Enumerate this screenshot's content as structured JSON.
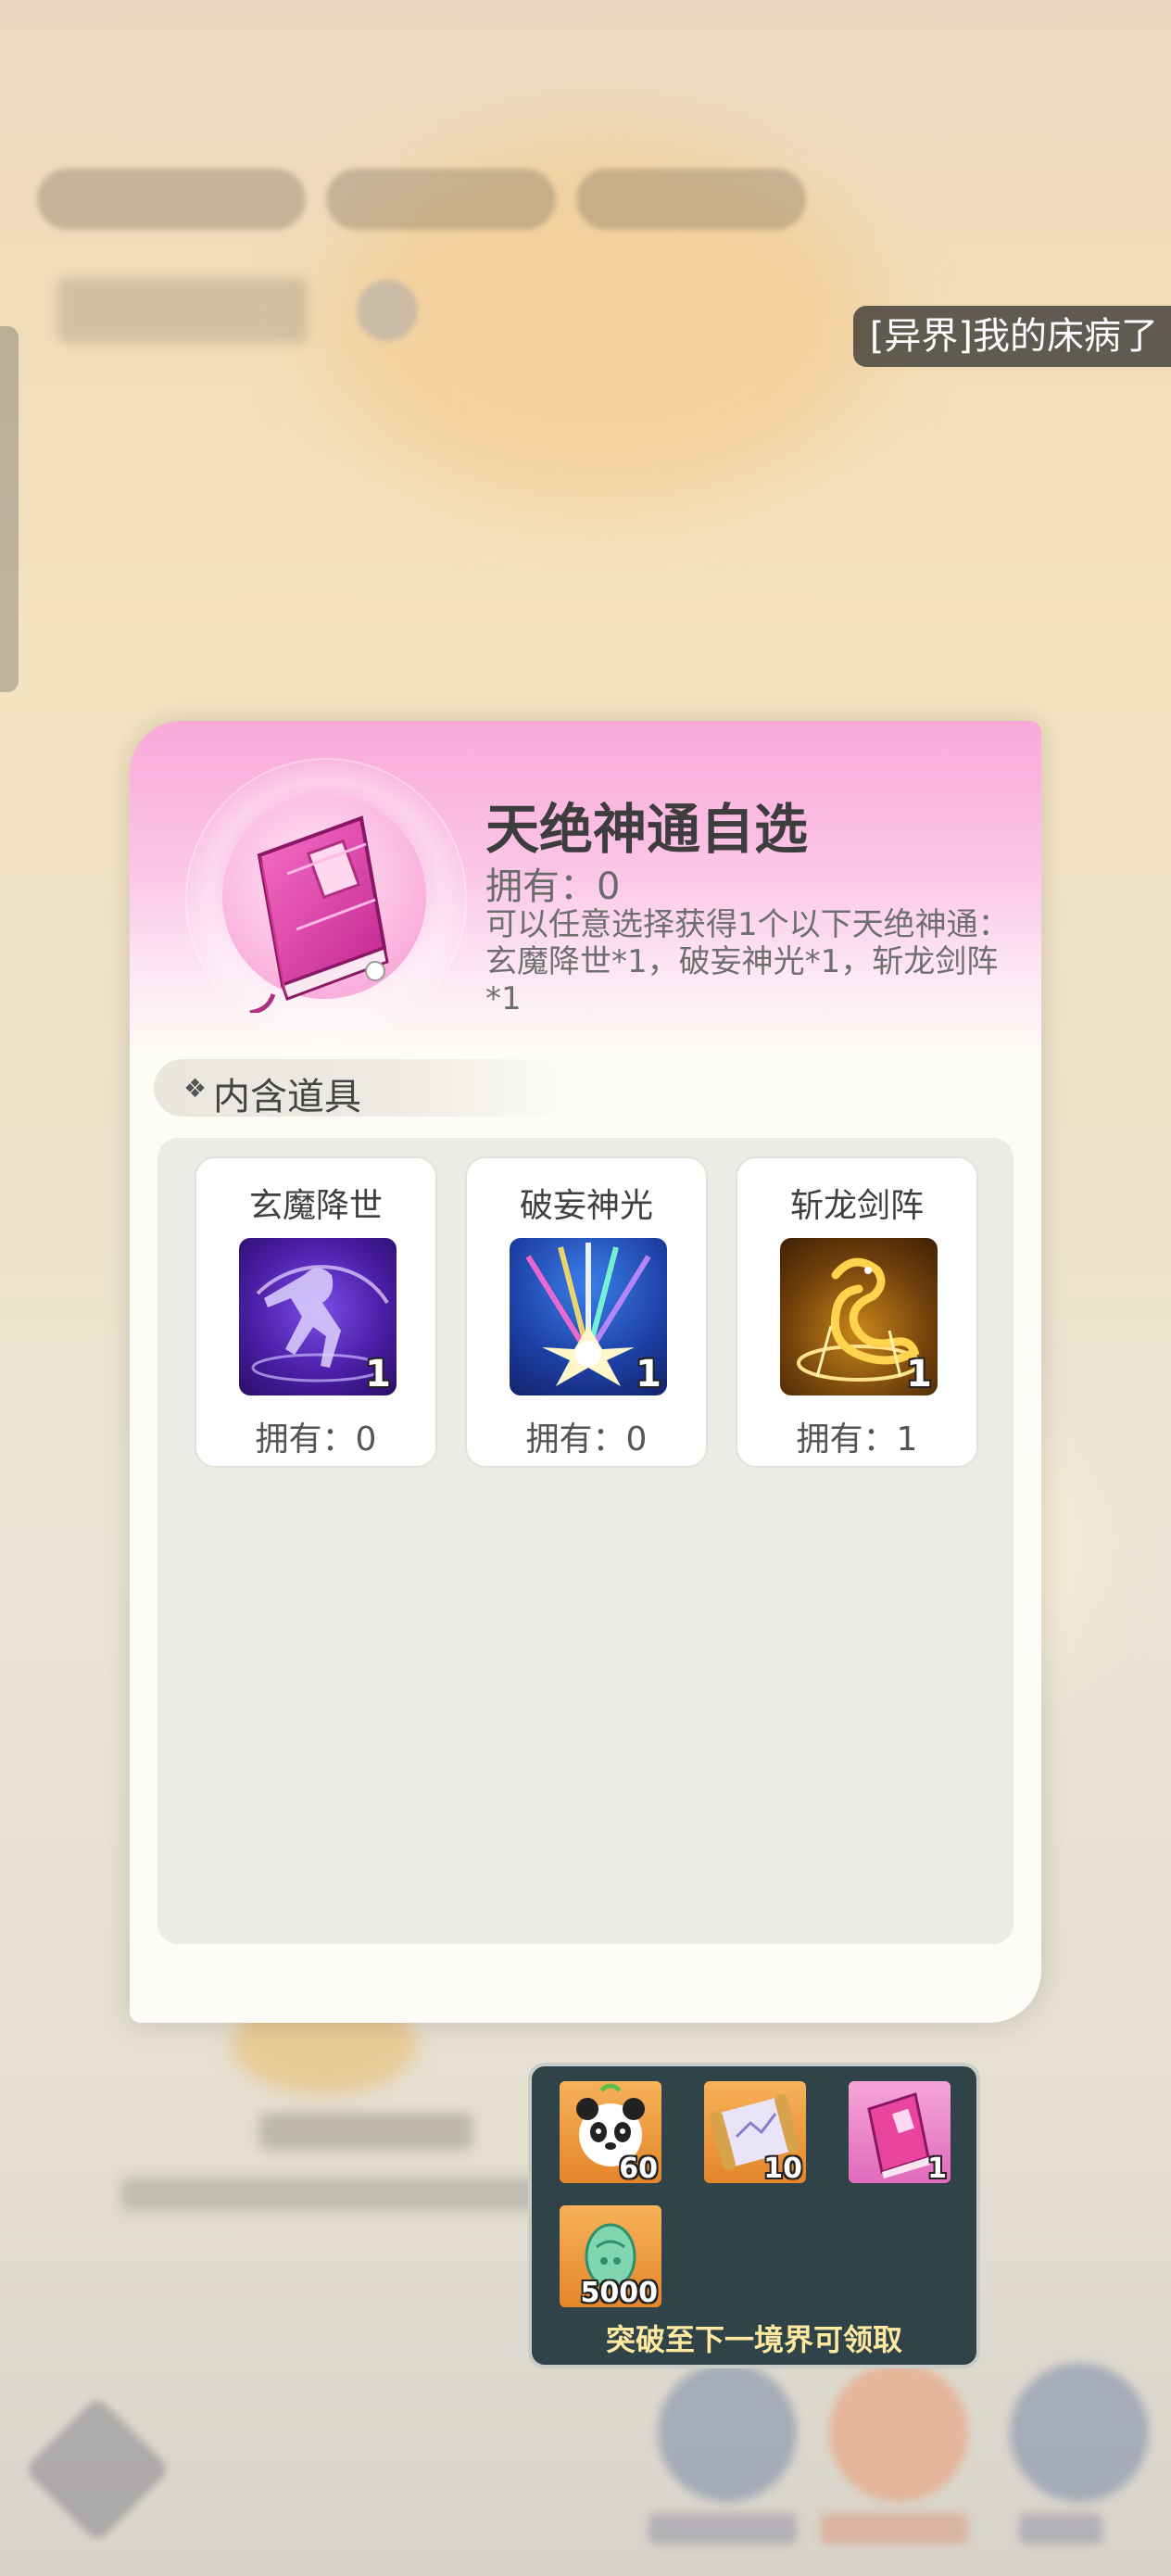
{
  "notice": {
    "text": "[异界]我的床病了"
  },
  "dialog": {
    "title": "天绝神通自选",
    "owned": "拥有：0",
    "description": "可以任意选择获得1个以下天绝神通：玄魔降世*1，破妄神光*1，斩龙剑阵*1",
    "section_label": "内含道具",
    "items": [
      {
        "name": "玄魔降世",
        "qty": "1",
        "owned": "拥有：0",
        "icon": "shadow-demon-icon"
      },
      {
        "name": "破妄神光",
        "qty": "1",
        "owned": "拥有：0",
        "icon": "divine-light-burst-icon"
      },
      {
        "name": "斩龙剑阵",
        "qty": "1",
        "owned": "拥有：1",
        "icon": "golden-dragon-icon"
      }
    ]
  },
  "rewards": {
    "items": [
      {
        "icon": "panda-icon",
        "qty": "60"
      },
      {
        "icon": "scroll-icon",
        "qty": "10"
      },
      {
        "icon": "pink-book-icon",
        "qty": "1"
      },
      {
        "icon": "green-egg-icon",
        "qty": "5000"
      }
    ],
    "caption": "突破至下一境界可领取"
  },
  "colors": {
    "header_pink": "#f9a9d9",
    "reward_panel": "#2f4349",
    "caption_yellow": "#ffe9a0"
  }
}
